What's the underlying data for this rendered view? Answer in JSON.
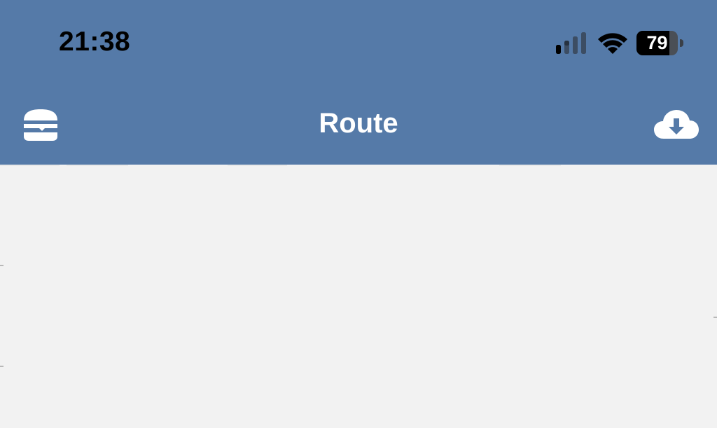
{
  "status_bar": {
    "time": "21:38",
    "battery_level": "79",
    "signal_icon": "cellular-signal-icon",
    "wifi_icon": "wifi-icon",
    "battery_icon": "battery-icon"
  },
  "nav_bar": {
    "title": "Route",
    "left_icon": "hamburger-menu-icon",
    "right_icon": "cloud-download-icon"
  },
  "colors": {
    "header_background": "#557aa8",
    "content_background": "#f2f2f2",
    "title_color": "#ffffff",
    "status_text_color": "#000000"
  }
}
